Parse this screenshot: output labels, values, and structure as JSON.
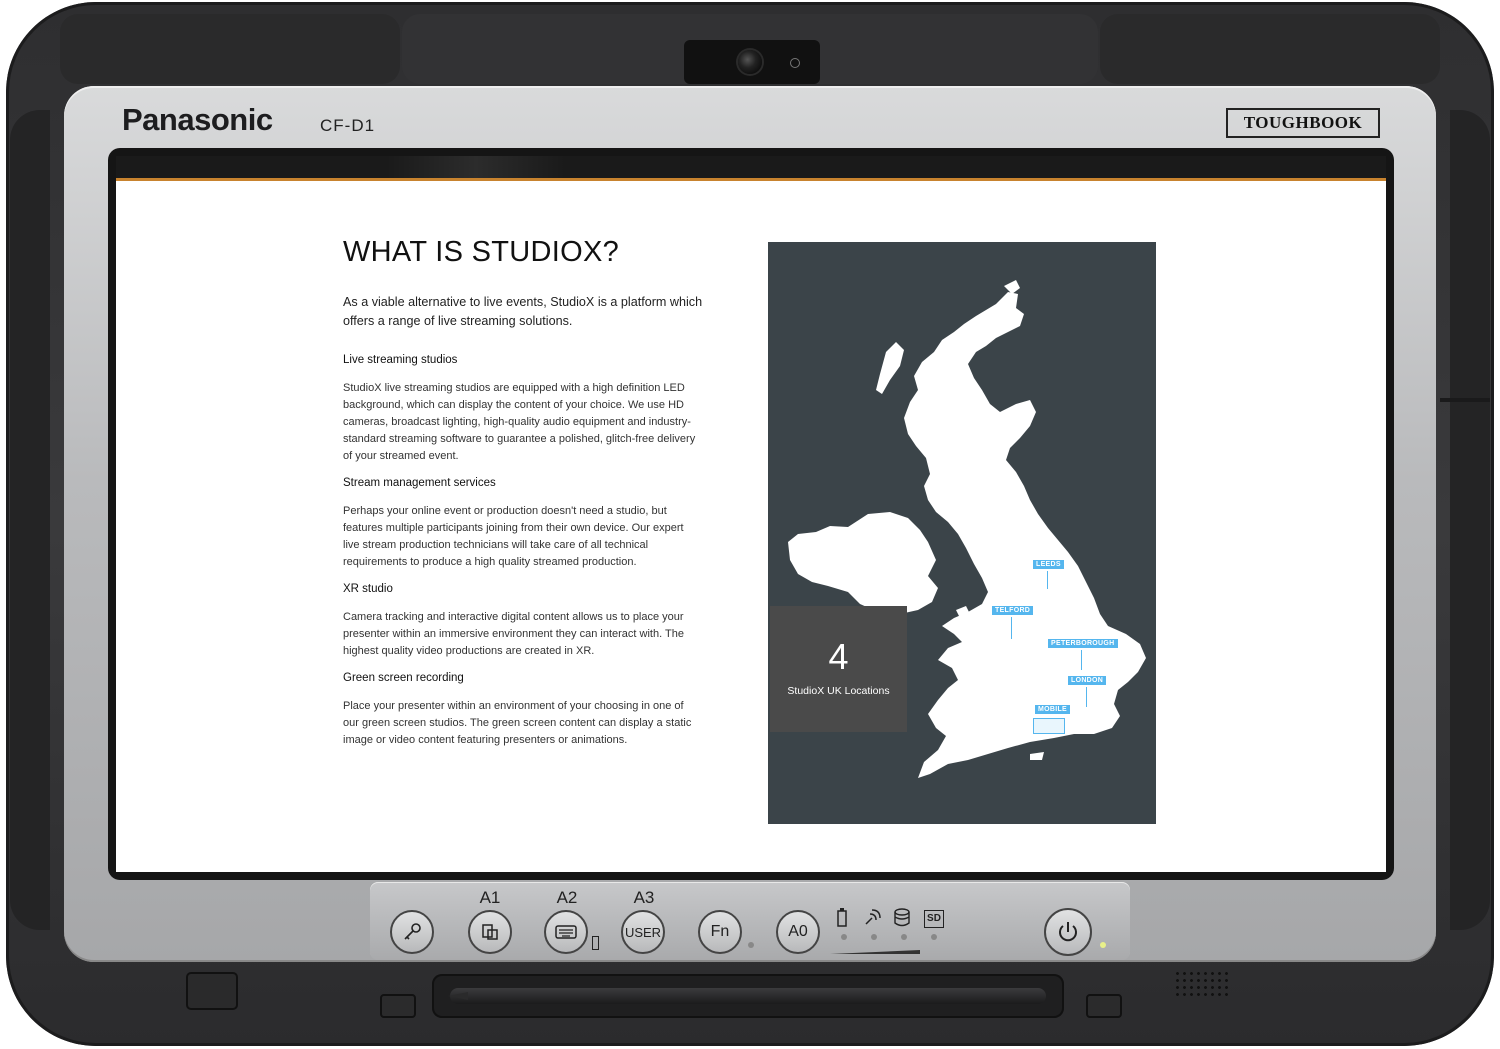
{
  "device": {
    "brand": "Panasonic",
    "model": "CF-D1",
    "series_badge": "TOUGHBOOK"
  },
  "page": {
    "title": "WHAT IS STUDIOX?",
    "intro": "As a viable alternative to live events, StudioX is a platform which offers a range of live streaming solutions.",
    "sections": [
      {
        "heading": "Live streaming studios",
        "body": "StudioX live streaming studios are equipped with a high definition LED background, which can display the content of your choice. We use HD cameras, broadcast lighting, high-quality audio equipment and industry-standard streaming software to guarantee a polished, glitch-free delivery of your streamed event."
      },
      {
        "heading": "Stream management services",
        "body": "Perhaps your online event or production doesn't need a studio, but features multiple participants joining from their own device. Our expert live stream production technicians will take care of all technical requirements to produce a high quality streamed production."
      },
      {
        "heading": "XR studio",
        "body": "Camera tracking and interactive digital content allows us to place your presenter within an immersive environment they can interact with. The highest quality video productions are created in XR."
      },
      {
        "heading": "Green screen recording",
        "body": "Place your presenter within an environment of your choosing in one of our green screen studios. The green screen content can display a static image or video content featuring presenters or animations."
      }
    ]
  },
  "map": {
    "stat_number": "4",
    "stat_label": "StudioX UK Locations",
    "locations": [
      "LEEDS",
      "TELFORD",
      "PETERBOROUGH",
      "LONDON",
      "MOBILE"
    ],
    "panel_color": "#3b4449",
    "tag_color": "#55b6ee"
  },
  "hardware": {
    "buttons": [
      {
        "label": "",
        "icon": "key-icon"
      },
      {
        "label": "A1",
        "icon": "rotate-screen-icon"
      },
      {
        "label": "A2",
        "icon": "keyboard-icon"
      },
      {
        "label": "A3",
        "icon": "USER"
      },
      {
        "label": "",
        "icon": "Fn"
      },
      {
        "label": "",
        "icon": "A0"
      },
      {
        "label": "",
        "icon": "power-icon"
      }
    ],
    "status_icons": [
      "battery-icon",
      "wireless-icon",
      "storage-icon",
      "SD"
    ]
  }
}
